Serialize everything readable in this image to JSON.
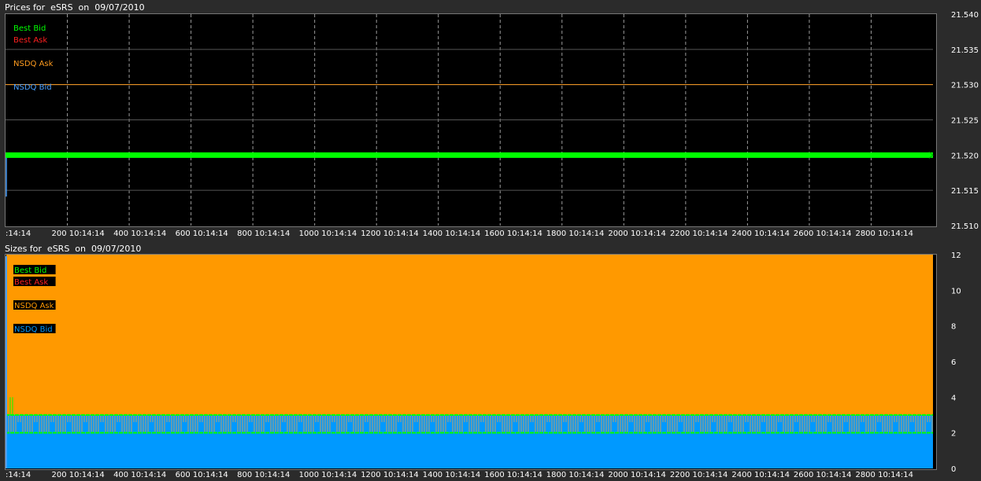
{
  "chart_data": [
    {
      "type": "line",
      "title": "Prices for  eSRS  on  09/07/2010",
      "x_ticks": [
        ":14:14",
        "200 10:14:14",
        "400 10:14:14",
        "600 10:14:14",
        "800 10:14:14",
        "1000 10:14:14",
        "1200 10:14:14",
        "1400 10:14:14",
        "1600 10:14:14",
        "1800 10:14:14",
        "2000 10:14:14",
        "2200 10:14:14",
        "2400 10:14:14",
        "2600 10:14:14",
        "2800 10:14:14"
      ],
      "x_tick_values": [
        0,
        200,
        400,
        600,
        800,
        1000,
        1200,
        1400,
        1600,
        1800,
        2000,
        2200,
        2400,
        2600,
        2800
      ],
      "xlim": [
        0,
        3000
      ],
      "y_ticks": [
        "21.540",
        "21.535",
        "21.530",
        "21.525",
        "21.520",
        "21.515",
        "21.510"
      ],
      "ylim": [
        21.51,
        21.54
      ],
      "grid": true,
      "legend_position": "top-left",
      "series": [
        {
          "name": "Best Bid",
          "color": "#00ff00",
          "values": [
            21.52,
            21.52
          ]
        },
        {
          "name": "Best Ask",
          "color": "#ff2020",
          "values": []
        },
        {
          "name": "NSDQ Ask",
          "color": "#ff9c1f",
          "values": [
            21.53,
            21.53
          ]
        },
        {
          "name": "NSDQ Bid",
          "color": "#4aa0ff",
          "values": [
            21.515,
            21.52
          ]
        }
      ]
    },
    {
      "type": "area",
      "title": "Sizes for  eSRS  on  09/07/2010",
      "x_ticks": [
        ":14:14",
        "200 10:14:14",
        "400 10:14:14",
        "600 10:14:14",
        "800 10:14:14",
        "1000 10:14:14",
        "1200 10:14:14",
        "1400 10:14:14",
        "1600 10:14:14",
        "1800 10:14:14",
        "2000 10:14:14",
        "2200 10:14:14",
        "2400 10:14:14",
        "2600 10:14:14",
        "2800 10:14:14"
      ],
      "x_tick_values": [
        0,
        200,
        400,
        600,
        800,
        1000,
        1200,
        1400,
        1600,
        1800,
        2000,
        2200,
        2400,
        2600,
        2800
      ],
      "xlim": [
        0,
        3000
      ],
      "y_ticks": [
        "12",
        "10",
        "8",
        "6",
        "4",
        "2",
        "0"
      ],
      "ylim": [
        0,
        12
      ],
      "grid": false,
      "legend_position": "top-left",
      "series": [
        {
          "name": "Best Bid",
          "color": "#00ff00",
          "values": [
            2,
            3
          ]
        },
        {
          "name": "Best Ask",
          "color": "#ff2020",
          "values": []
        },
        {
          "name": "NSDQ Ask",
          "color": "#ff9900",
          "values": [
            12,
            12
          ]
        },
        {
          "name": "NSDQ Bid",
          "color": "#0099ff",
          "values": [
            2.2,
            2.2
          ]
        }
      ]
    }
  ]
}
